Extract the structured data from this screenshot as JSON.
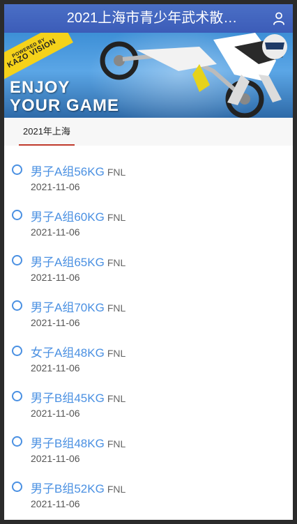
{
  "header": {
    "title": "2021上海市青少年武术散…",
    "user_icon": "user-icon"
  },
  "banner": {
    "ribbon_line1": "POWERED BY",
    "ribbon_line2": "KAZO VISION",
    "tagline_line1": "ENJOY",
    "tagline_line2": "YOUR GAME"
  },
  "tabs": [
    {
      "label": "2021年上海",
      "active": true
    }
  ],
  "events": [
    {
      "name": "男子A组56KG",
      "status": "FNL",
      "date": "2021-11-06"
    },
    {
      "name": "男子A组60KG",
      "status": "FNL",
      "date": "2021-11-06"
    },
    {
      "name": "男子A组65KG",
      "status": "FNL",
      "date": "2021-11-06"
    },
    {
      "name": "男子A组70KG",
      "status": "FNL",
      "date": "2021-11-06"
    },
    {
      "name": "女子A组48KG",
      "status": "FNL",
      "date": "2021-11-06"
    },
    {
      "name": "男子B组45KG",
      "status": "FNL",
      "date": "2021-11-06"
    },
    {
      "name": "男子B组48KG",
      "status": "FNL",
      "date": "2021-11-06"
    },
    {
      "name": "男子B组52KG",
      "status": "FNL",
      "date": "2021-11-06"
    }
  ],
  "colors": {
    "header_bg": "#3c5cb8",
    "accent_blue": "#4a90e2",
    "tab_underline": "#c0392b"
  }
}
